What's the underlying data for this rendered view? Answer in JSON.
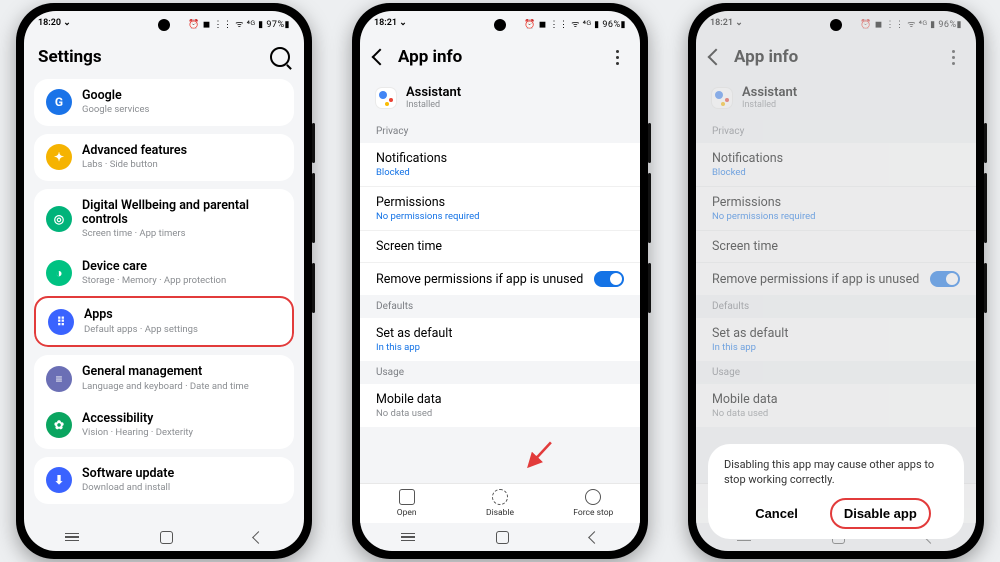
{
  "phone1": {
    "status": {
      "time": "18:20 ⌄",
      "right": "⏰ ◼ ⋮⋮ ᯤ ⁴ᴳ ▮ 97%▮"
    },
    "title": "Settings",
    "groups": [
      {
        "rows": [
          {
            "icon": "G",
            "bg": "#1a73e8",
            "title": "Google",
            "sub": "Google services"
          }
        ]
      },
      {
        "rows": [
          {
            "icon": "✦",
            "bg": "#f5b301",
            "title": "Advanced features",
            "sub": "Labs · Side button"
          }
        ]
      },
      {
        "rows": [
          {
            "icon": "◎",
            "bg": "#00b37a",
            "title": "Digital Wellbeing and parental controls",
            "sub": "Screen time · App timers"
          },
          {
            "icon": "◑",
            "bg": "#00c282",
            "title": "Device care",
            "sub": "Storage · Memory · App protection"
          },
          {
            "icon": "⠿",
            "bg": "#3a63ff",
            "title": "Apps",
            "sub": "Default apps · App settings",
            "highlight": true
          }
        ]
      },
      {
        "rows": [
          {
            "icon": "≡",
            "bg": "#6b6fb5",
            "title": "General management",
            "sub": "Language and keyboard · Date and time"
          },
          {
            "icon": "✿",
            "bg": "#0aa560",
            "title": "Accessibility",
            "sub": "Vision · Hearing · Dexterity"
          }
        ]
      },
      {
        "rows": [
          {
            "icon": "⬇",
            "bg": "#3a63ff",
            "title": "Software update",
            "sub": "Download and install"
          }
        ]
      }
    ]
  },
  "phone2": {
    "status": {
      "time": "18:21 ⌄",
      "right": "⏰ ◼ ⋮⋮ ᯤ ⁴ᴳ ▮ 96%▮"
    },
    "title": "App info",
    "app": {
      "name": "Assistant",
      "sub": "Installed"
    },
    "sections": [
      {
        "header": "Privacy",
        "items": [
          {
            "t": "Notifications",
            "s": "Blocked",
            "cls": "blue"
          },
          {
            "t": "Permissions",
            "s": "No permissions required",
            "cls": "blue"
          },
          {
            "t": "Screen time"
          },
          {
            "t": "Remove permissions if app is unused",
            "toggle": true
          }
        ]
      },
      {
        "header": "Defaults",
        "items": [
          {
            "t": "Set as default",
            "s": "In this app",
            "cls": "blue"
          }
        ]
      },
      {
        "header": "Usage",
        "items": [
          {
            "t": "Mobile data",
            "s": "No data used",
            "cls": "grey"
          }
        ]
      }
    ],
    "actions": [
      {
        "label": "Open",
        "icon": "square"
      },
      {
        "label": "Disable",
        "icon": "circle"
      },
      {
        "label": "Force stop",
        "icon": "stop"
      }
    ]
  },
  "phone3": {
    "status": {
      "time": "18:21 ⌄",
      "right": "⏰ ◼ ⋮⋮ ᯤ ⁴ᴳ ▮ 96%▮"
    },
    "title": "App info",
    "dialog": {
      "message": "Disabling this app may cause other apps to stop working correctly.",
      "cancel": "Cancel",
      "confirm": "Disable app"
    }
  }
}
